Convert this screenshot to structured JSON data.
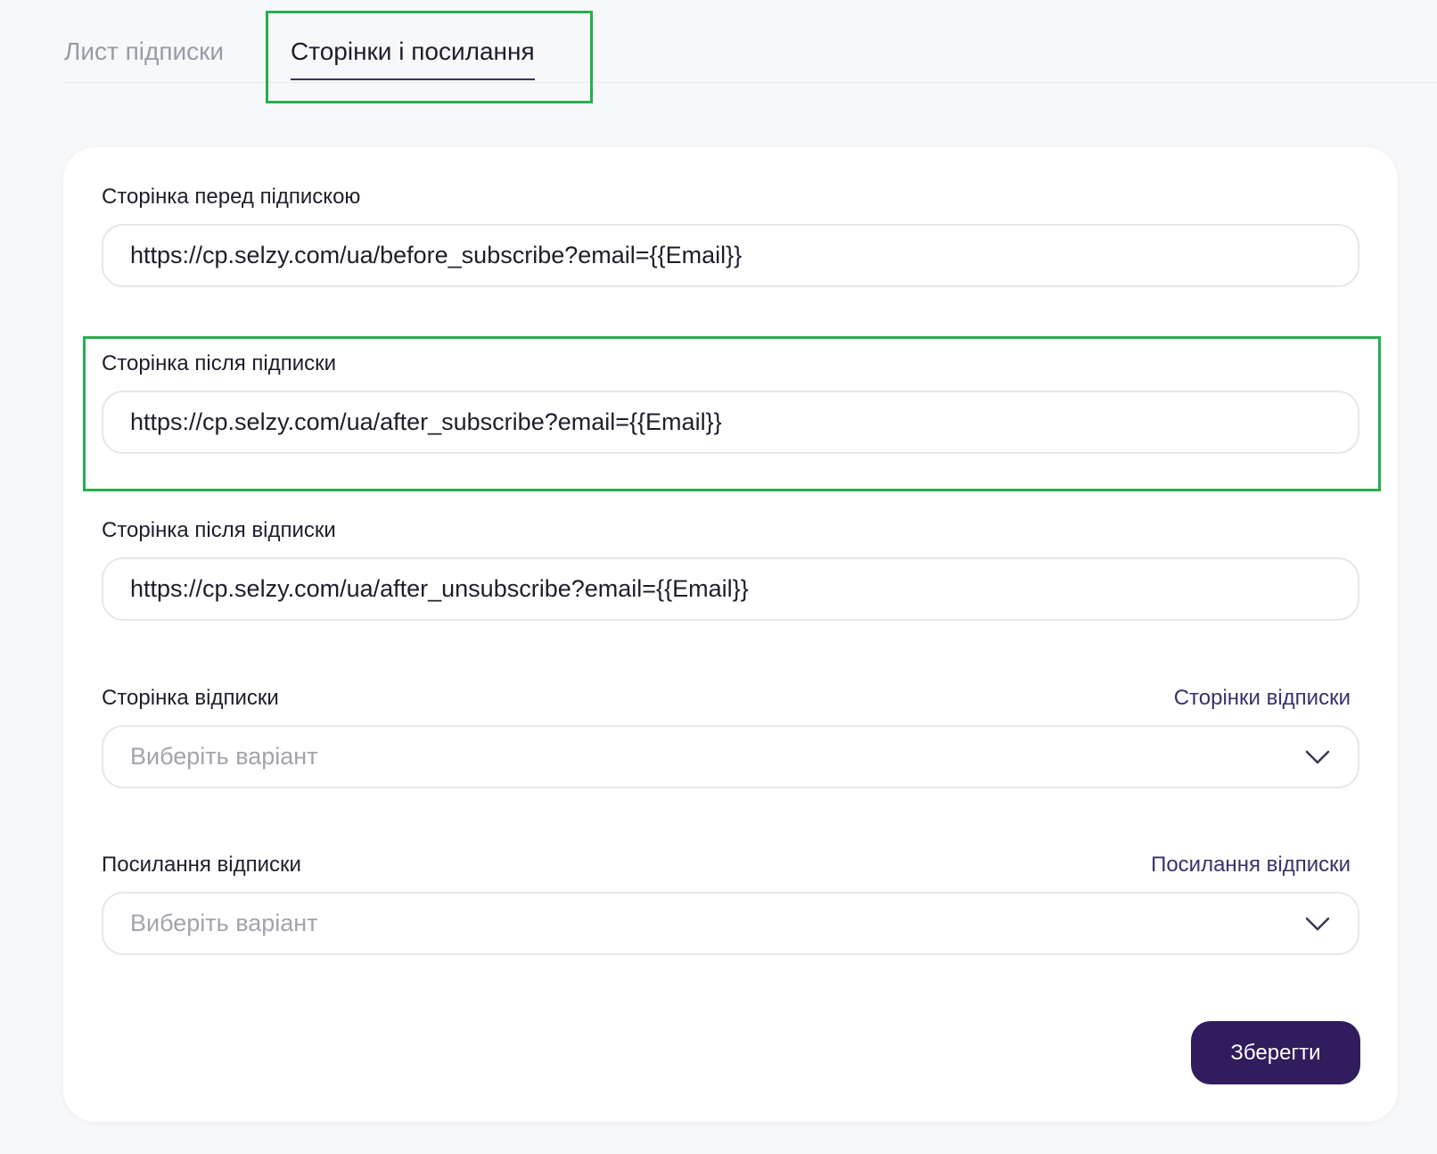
{
  "tabs": [
    {
      "label": "Лист підписки",
      "active": false
    },
    {
      "label": "Сторінки і посилання",
      "active": true
    }
  ],
  "fields": {
    "before_subscribe": {
      "label": "Сторінка перед підпискою",
      "value": "https://cp.selzy.com/ua/before_subscribe?email={{Email}}"
    },
    "after_subscribe": {
      "label": "Сторінка після підписки",
      "value": "https://cp.selzy.com/ua/after_subscribe?email={{Email}}"
    },
    "after_unsubscribe": {
      "label": "Сторінка після відписки",
      "value": "https://cp.selzy.com/ua/after_unsubscribe?email={{Email}}"
    },
    "unsubscribe_page": {
      "label": "Сторінка відписки",
      "link": "Сторінки відписки",
      "placeholder": "Виберіть варіант"
    },
    "unsubscribe_link": {
      "label": "Посилання відписки",
      "link": "Посилання відписки",
      "placeholder": "Виберіть варіант"
    }
  },
  "save_label": "Зберегти",
  "colors": {
    "accent": "#311c5e",
    "highlight": "#27ae4f",
    "link": "#3b2f6b"
  }
}
